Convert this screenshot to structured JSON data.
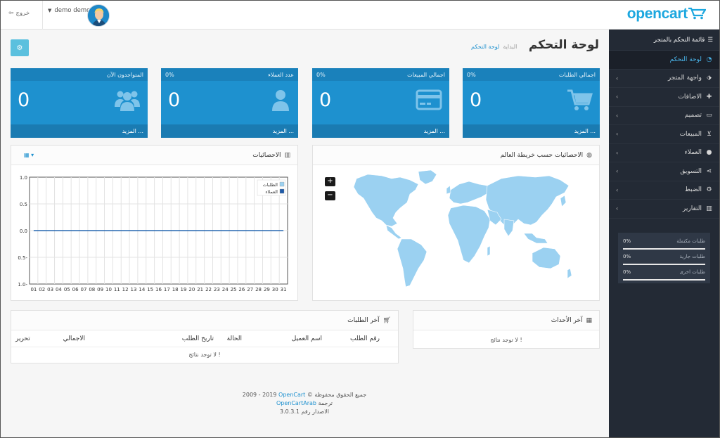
{
  "header": {
    "logout_label": "خروج",
    "user_name": "demo demo",
    "logo_text": "opencart"
  },
  "sidebar": {
    "title": "قائمة التحكم بالمتجر",
    "items": [
      {
        "label": "لوحة التحكم",
        "icon": "dashboard-icon",
        "active": true,
        "has_children": false
      },
      {
        "label": "واجهة المتجر",
        "icon": "tag-icon",
        "active": false,
        "has_children": true
      },
      {
        "label": "الاضافات",
        "icon": "puzzle-icon",
        "active": false,
        "has_children": true
      },
      {
        "label": "تصميم",
        "icon": "monitor-icon",
        "active": false,
        "has_children": true
      },
      {
        "label": "المبيعات",
        "icon": "cart-icon",
        "active": false,
        "has_children": true
      },
      {
        "label": "العملاء",
        "icon": "user-icon",
        "active": false,
        "has_children": true
      },
      {
        "label": "التسويق",
        "icon": "share-icon",
        "active": false,
        "has_children": true
      },
      {
        "label": "الضبط",
        "icon": "gear-icon",
        "active": false,
        "has_children": true
      },
      {
        "label": "التقارير",
        "icon": "bar-chart-icon",
        "active": false,
        "has_children": true
      }
    ],
    "stats": [
      {
        "label": "طلبات مكتملة",
        "percent": "0%",
        "fraction": 0
      },
      {
        "label": "طلبات جارية",
        "percent": "0%",
        "fraction": 0
      },
      {
        "label": "طلبات اخرى",
        "percent": "0%",
        "fraction": 0
      }
    ]
  },
  "page": {
    "title": "لوحة التحكم",
    "breadcrumb": [
      "البداية",
      "لوحة التحكم"
    ]
  },
  "tiles": [
    {
      "title": "اجمالي الطلبات",
      "percent": "0%",
      "value": "0",
      "more": "المزيد ...",
      "icon": "cart-icon"
    },
    {
      "title": "اجمالي المبيعات",
      "percent": "0%",
      "value": "0",
      "more": "المزيد ...",
      "icon": "credit-card-icon"
    },
    {
      "title": "عدد العملاء",
      "percent": "0%",
      "value": "0",
      "more": "المزيد ...",
      "icon": "user-icon"
    },
    {
      "title": "المتواجدون الآن",
      "percent": "",
      "value": "0",
      "more": "المزيد ...",
      "icon": "users-icon"
    }
  ],
  "map_panel": {
    "title": "الاحصائيات حسب خريطة العالم",
    "zoom_in": "+",
    "zoom_out": "−"
  },
  "chart_panel": {
    "title": "الاحصائيات"
  },
  "chart_data": {
    "type": "line",
    "x": [
      "01",
      "02",
      "03",
      "04",
      "05",
      "06",
      "07",
      "08",
      "09",
      "10",
      "11",
      "12",
      "13",
      "14",
      "15",
      "16",
      "17",
      "18",
      "19",
      "20",
      "21",
      "22",
      "23",
      "24",
      "25",
      "26",
      "27",
      "28",
      "29",
      "30",
      "31"
    ],
    "series": [
      {
        "name": "الطلبات",
        "color": "#9bd1f1",
        "values": [
          0,
          0,
          0,
          0,
          0,
          0,
          0,
          0,
          0,
          0,
          0,
          0,
          0,
          0,
          0,
          0,
          0,
          0,
          0,
          0,
          0,
          0,
          0,
          0,
          0,
          0,
          0,
          0,
          0,
          0,
          0
        ]
      },
      {
        "name": "العملاء",
        "color": "#1e5aa8",
        "values": [
          0,
          0,
          0,
          0,
          0,
          0,
          0,
          0,
          0,
          0,
          0,
          0,
          0,
          0,
          0,
          0,
          0,
          0,
          0,
          0,
          0,
          0,
          0,
          0,
          0,
          0,
          0,
          0,
          0,
          0,
          0
        ]
      }
    ],
    "yticks": [
      "1.0",
      "0.5",
      "0.0",
      "0.5-",
      "1.0-"
    ],
    "ylim": [
      -1,
      1
    ],
    "grid": true,
    "legend": "top-right"
  },
  "events_panel": {
    "title": "آخر الأحداث",
    "empty": "لا توجد نتائج !"
  },
  "orders_panel": {
    "title": "آخر الطلبات",
    "columns": [
      "رقم الطلب",
      "اسم العميل",
      "الحالة",
      "تاريخ الطلب",
      "الاجمالي",
      "تحرير"
    ],
    "empty": "لا توجد نتائج !"
  },
  "footer": {
    "line1_link": "OpenCart",
    "line1_prefix": "2009 - 2019",
    "line1_suffix": "© جميع الحقوق محفوظة",
    "line2_prefix": "ترجمة",
    "line2_link": "OpenCartArab",
    "line3": "الاصدار رقم 3.0.3.1"
  },
  "colors": {
    "accent": "#1e91cf",
    "sidebar_bg": "#232a35",
    "map_land": "#9bd1f1"
  }
}
